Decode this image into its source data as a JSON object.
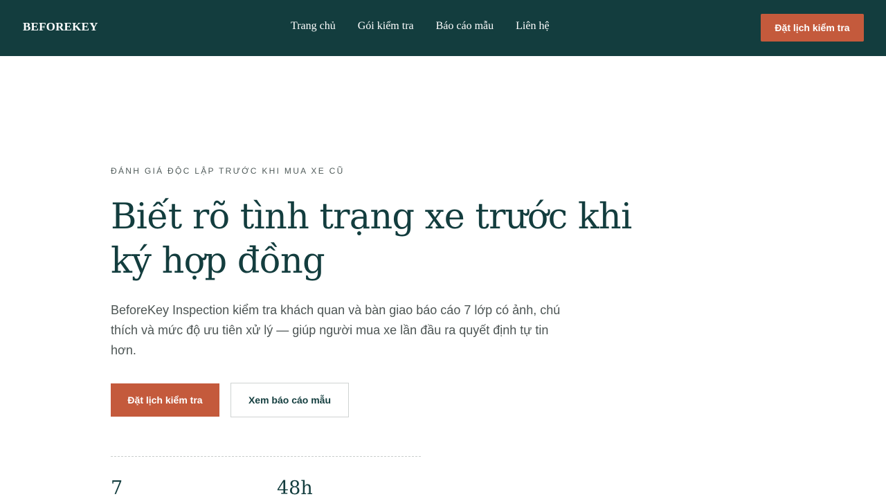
{
  "brand": "BEFOREKEY",
  "nav": {
    "items": [
      "Trang chủ",
      "Gói kiểm tra",
      "Báo cáo mẫu",
      "Liên hệ"
    ],
    "cta": "Đặt lịch kiểm tra"
  },
  "hero": {
    "eyebrow": "ĐÁNH GIÁ ĐỘC LẬP TRƯỚC KHI MUA XE CŨ",
    "title_line1": "Biết rõ tình trạng xe trước khi",
    "title_line2": "ký hợp đồng",
    "lead": "BeforeKey Inspection kiểm tra khách quan và bàn giao báo cáo 7 lớp có ảnh, chú thích và mức độ ưu tiên xử lý — giúp người mua xe lần đầu ra quyết định tự tin hơn.",
    "primary_button": "Đặt lịch kiểm tra",
    "secondary_button": "Xem báo cáo mẫu"
  },
  "stats": [
    {
      "value": "7"
    },
    {
      "value": "48h"
    }
  ],
  "colors": {
    "nav_bg": "#133d3e",
    "accent": "#c45a3c",
    "heading": "#133d3e",
    "body_text": "#4d5554"
  }
}
